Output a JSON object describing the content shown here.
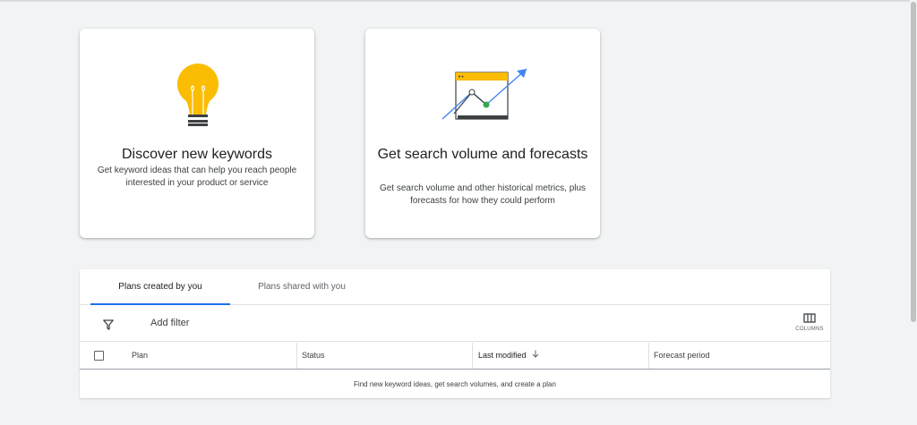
{
  "cards": [
    {
      "title": "Discover new keywords",
      "description": "Get keyword ideas that can help you reach people interested in your product or service"
    },
    {
      "title": "Get search volume and forecasts",
      "description": "Get search volume and other historical metrics, plus forecasts for how they could perform"
    }
  ],
  "tabs": {
    "active": "Plans created by you",
    "other": "Plans shared with you"
  },
  "toolbar": {
    "add_filter": "Add filter",
    "columns_label": "COLUMNS",
    "filter_icon": "filter-icon",
    "columns_icon": "columns-icon"
  },
  "table": {
    "columns": [
      "Plan",
      "Status",
      "Last modified",
      "Forecast period"
    ],
    "sorted_column": "Last modified",
    "sort_direction": "descending",
    "empty_message": "Find new keyword ideas, get search volumes, and create a plan"
  },
  "colors": {
    "accent": "#1a73e8",
    "bulb_yellow": "#fbbc04",
    "chart_green": "#34a853",
    "arrow_blue": "#4285f4"
  }
}
